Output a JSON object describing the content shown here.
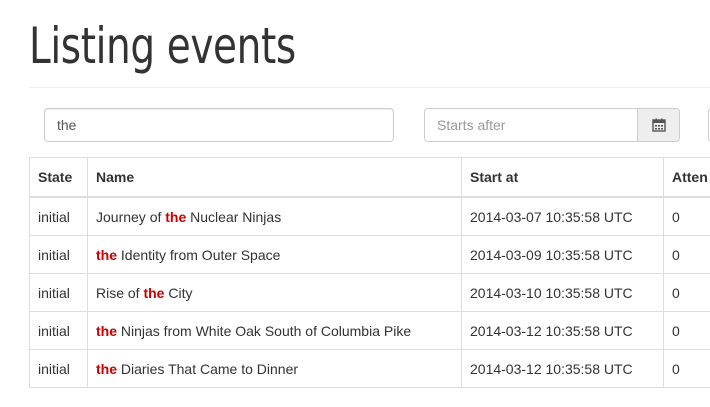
{
  "page": {
    "title": "Listing events"
  },
  "filters": {
    "search_value": "the",
    "starts_after_placeholder": "Starts after",
    "calendar_icon": "calendar-icon"
  },
  "table": {
    "headers": [
      "State",
      "Name",
      "Start at",
      "Atten"
    ],
    "highlight_term": "the",
    "highlight_color": "#cc0000",
    "rows": [
      {
        "state": "initial",
        "name_before": "Journey of ",
        "name_match": "the",
        "name_after": " Nuclear Ninjas",
        "start_at": "2014-03-07 10:35:58 UTC",
        "attendees": "0"
      },
      {
        "state": "initial",
        "name_before": "",
        "name_match": "the",
        "name_after": " Identity from Outer Space",
        "start_at": "2014-03-09 10:35:58 UTC",
        "attendees": "0"
      },
      {
        "state": "initial",
        "name_before": "Rise of ",
        "name_match": "the",
        "name_after": " City",
        "start_at": "2014-03-10 10:35:58 UTC",
        "attendees": "0"
      },
      {
        "state": "initial",
        "name_before": "",
        "name_match": "the",
        "name_after": " Ninjas from White Oak South of Columbia Pike",
        "start_at": "2014-03-12 10:35:58 UTC",
        "attendees": "0"
      },
      {
        "state": "initial",
        "name_before": "",
        "name_match": "the",
        "name_after": " Diaries That Came to Dinner",
        "start_at": "2014-03-12 10:35:58 UTC",
        "attendees": "0"
      }
    ]
  }
}
